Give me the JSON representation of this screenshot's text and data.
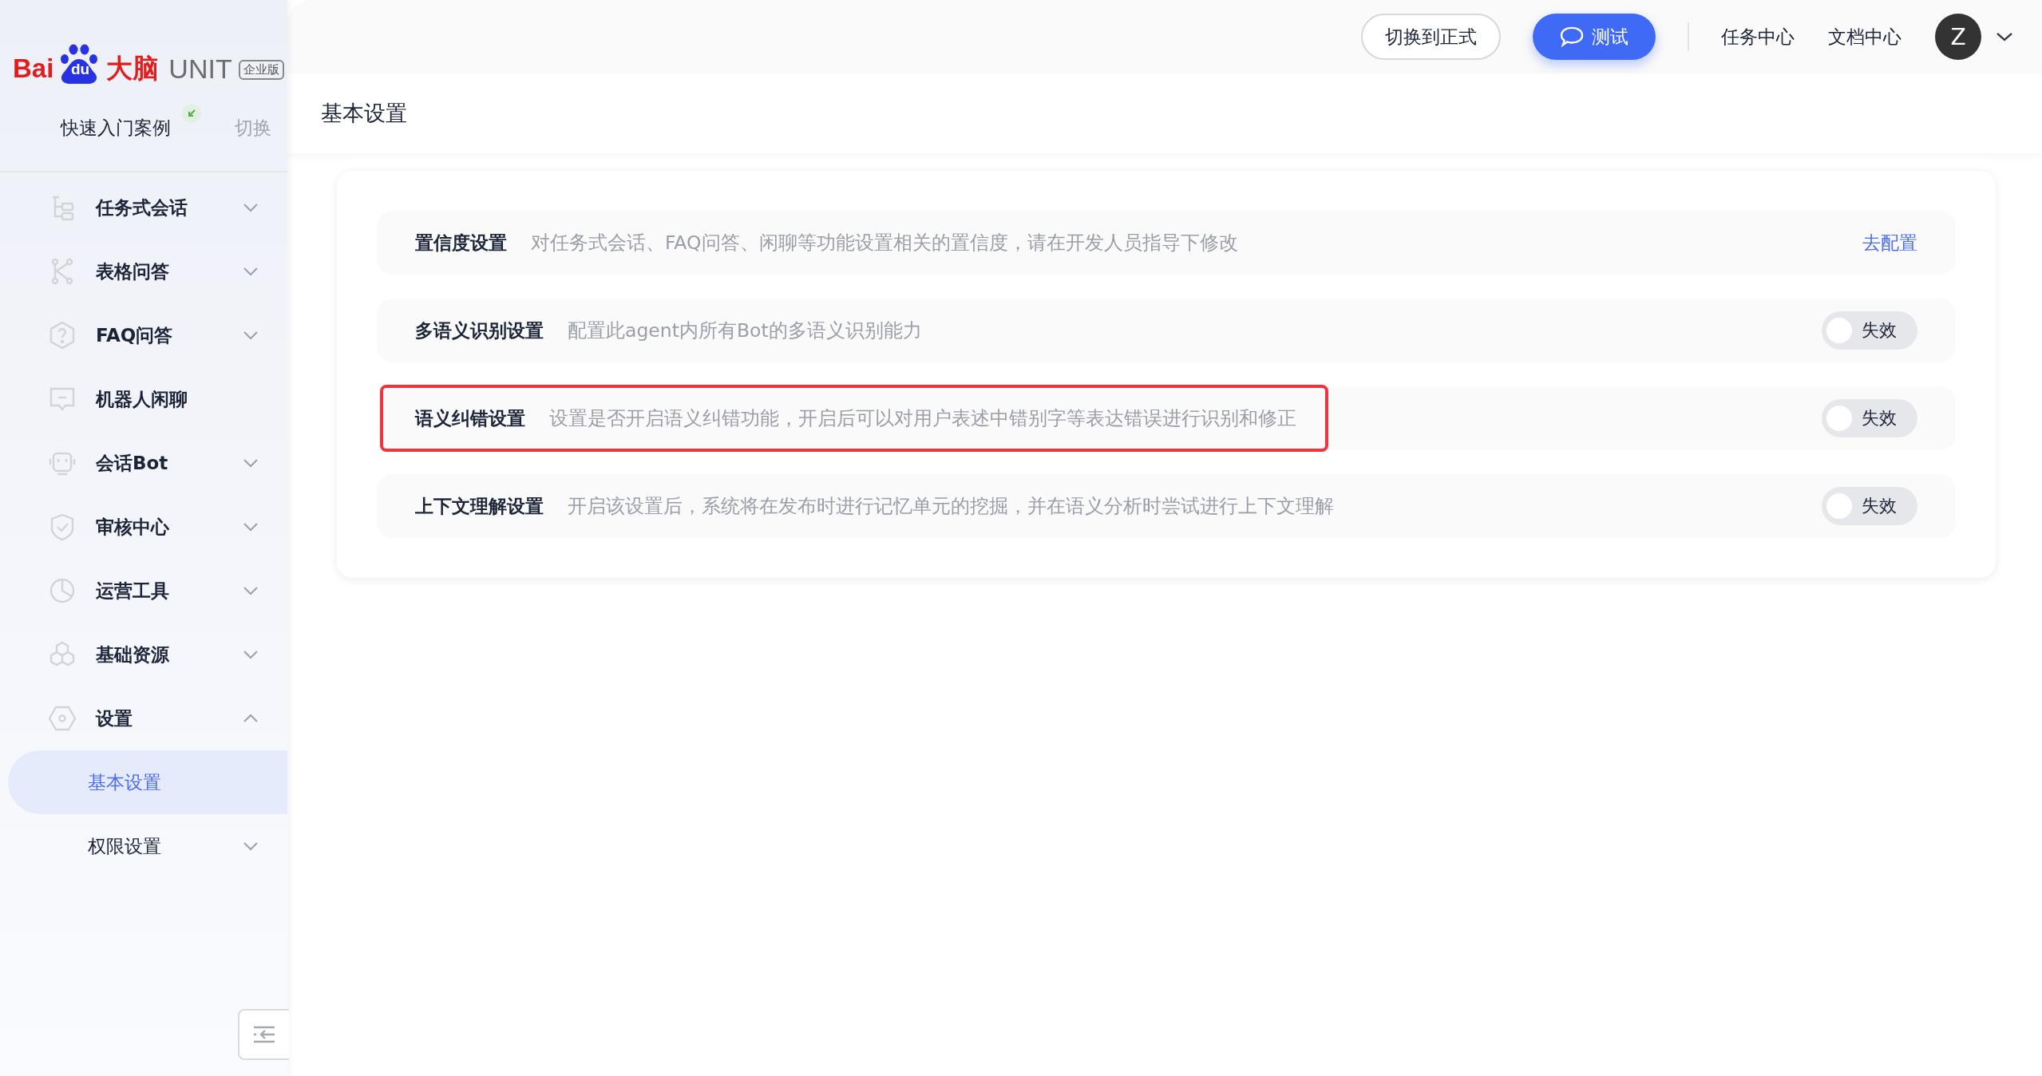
{
  "logo": {
    "brand": "Bai",
    "brand_tail": "du",
    "brain": "大脑",
    "product": "UNIT",
    "edition": "企业版"
  },
  "project": {
    "name": "快速入门案例",
    "switch": "切换"
  },
  "sidebar": {
    "items": [
      {
        "label": "任务式会话",
        "expanded": false,
        "selected": false
      },
      {
        "label": "表格问答",
        "expanded": false,
        "selected": false
      },
      {
        "label": "FAQ问答",
        "expanded": false,
        "selected": false
      },
      {
        "label": "机器人闲聊",
        "selected": false
      },
      {
        "label": "会话Bot",
        "expanded": false,
        "selected": false
      },
      {
        "label": "审核中心",
        "expanded": false,
        "selected": false
      },
      {
        "label": "运营工具",
        "expanded": false,
        "selected": false
      },
      {
        "label": "基础资源",
        "expanded": false,
        "selected": false
      },
      {
        "label": "设置",
        "expanded": true,
        "selected": false,
        "children": [
          {
            "label": "基本设置",
            "selected": true
          },
          {
            "label": "权限设置",
            "expanded": false,
            "selected": false
          }
        ]
      }
    ]
  },
  "topbar": {
    "switch_button": "切换到正式",
    "test_button": "测试",
    "links": [
      "任务中心",
      "文档中心"
    ],
    "avatar": "Z"
  },
  "page_title": "基本设置",
  "settings": [
    {
      "kind": "link",
      "title": "置信度设置",
      "description": "对任务式会话、FAQ问答、闲聊等功能设置相关的置信度，请在开发人员指导下修改",
      "link": "去配置",
      "highlighted": false
    },
    {
      "kind": "toggle",
      "title": "多语义识别设置",
      "description": "配置此agent内所有Bot的多语义识别能力",
      "on": false,
      "state_label": "失效",
      "highlighted": false
    },
    {
      "kind": "toggle",
      "title": "语义纠错设置",
      "description": "设置是否开启语义纠错功能，开启后可以对用户表述中错别字等表达错误进行识别和修正",
      "on": false,
      "state_label": "失效",
      "highlighted": true
    },
    {
      "kind": "toggle",
      "title": "上下文理解设置",
      "description": "开启该设置后，系统将在发布时进行记忆单元的挖掘，并在语义分析时尝试进行上下文理解",
      "on": false,
      "state_label": "失效",
      "highlighted": false
    }
  ]
}
